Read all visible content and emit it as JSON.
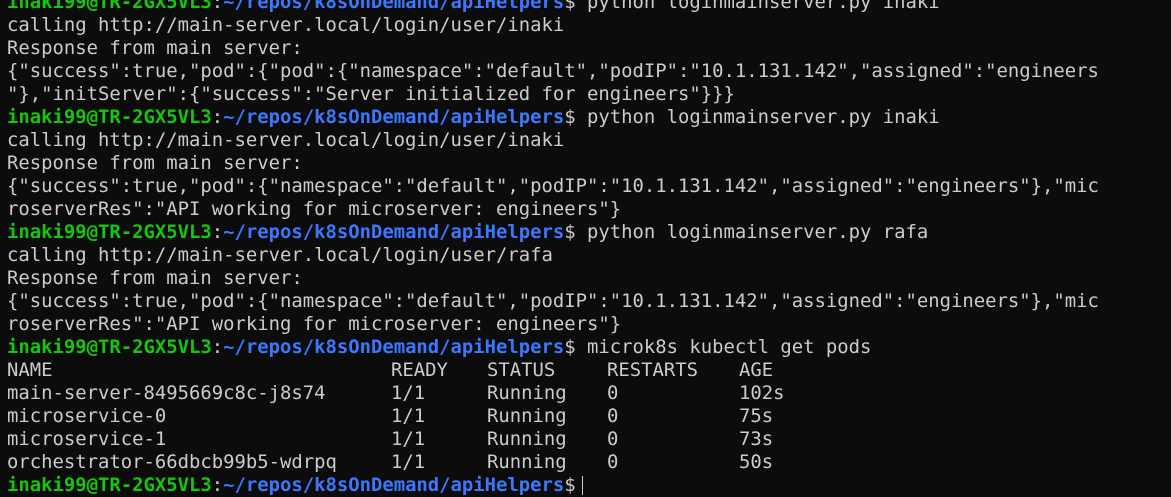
{
  "blocks": [
    {
      "prompt": {
        "user": "inaki99@TR-2GX5VL3",
        "path": "~/repos/k8sOnDemand/apiHelpers",
        "symbol": "$",
        "command": "python loginmainserver.py inaki"
      },
      "output": [
        "calling http://main-server.local/login/user/inaki",
        "Response from main server:",
        "{\"success\":true,\"pod\":{\"pod\":{\"namespace\":\"default\",\"podIP\":\"10.1.131.142\",\"assigned\":\"engineers",
        "\"},\"initServer\":{\"success\":\"Server initialized for engineers\"}}}"
      ]
    },
    {
      "prompt": {
        "user": "inaki99@TR-2GX5VL3",
        "path": "~/repos/k8sOnDemand/apiHelpers",
        "symbol": "$",
        "command": "python loginmainserver.py inaki"
      },
      "output": [
        "calling http://main-server.local/login/user/inaki",
        "Response from main server:",
        "{\"success\":true,\"pod\":{\"namespace\":\"default\",\"podIP\":\"10.1.131.142\",\"assigned\":\"engineers\"},\"mic",
        "roserverRes\":\"API working for microserver: engineers\"}"
      ]
    },
    {
      "prompt": {
        "user": "inaki99@TR-2GX5VL3",
        "path": "~/repos/k8sOnDemand/apiHelpers",
        "symbol": "$",
        "command": "python loginmainserver.py rafa"
      },
      "output": [
        "calling http://main-server.local/login/user/rafa",
        "Response from main server:",
        "{\"success\":true,\"pod\":{\"namespace\":\"default\",\"podIP\":\"10.1.131.142\",\"assigned\":\"engineers\"},\"mic",
        "roserverRes\":\"API working for microserver: engineers\"}"
      ]
    },
    {
      "prompt": {
        "user": "inaki99@TR-2GX5VL3",
        "path": "~/repos/k8sOnDemand/apiHelpers",
        "symbol": "$",
        "command": "microk8s kubectl get pods"
      },
      "output": []
    }
  ],
  "pods_table": {
    "headers": [
      "NAME",
      "READY",
      "STATUS",
      "RESTARTS",
      "AGE"
    ],
    "rows": [
      [
        "main-server-8495669c8c-j8s74",
        "1/1",
        "Running",
        "0",
        "102s"
      ],
      [
        "microservice-0",
        "1/1",
        "Running",
        "0",
        "75s"
      ],
      [
        "microservice-1",
        "1/1",
        "Running",
        "0",
        "73s"
      ],
      [
        "orchestrator-66dbcb99b5-wdrpq",
        "1/1",
        "Running",
        "0",
        "50s"
      ]
    ]
  },
  "last_prompt": {
    "user": "inaki99@TR-2GX5VL3",
    "path": "~/repos/k8sOnDemand/apiHelpers",
    "symbol": "$"
  },
  "colors": {
    "background": "#0c0c0c",
    "text": "#cccccc",
    "user": "#16c60c",
    "path": "#3b78ff"
  }
}
